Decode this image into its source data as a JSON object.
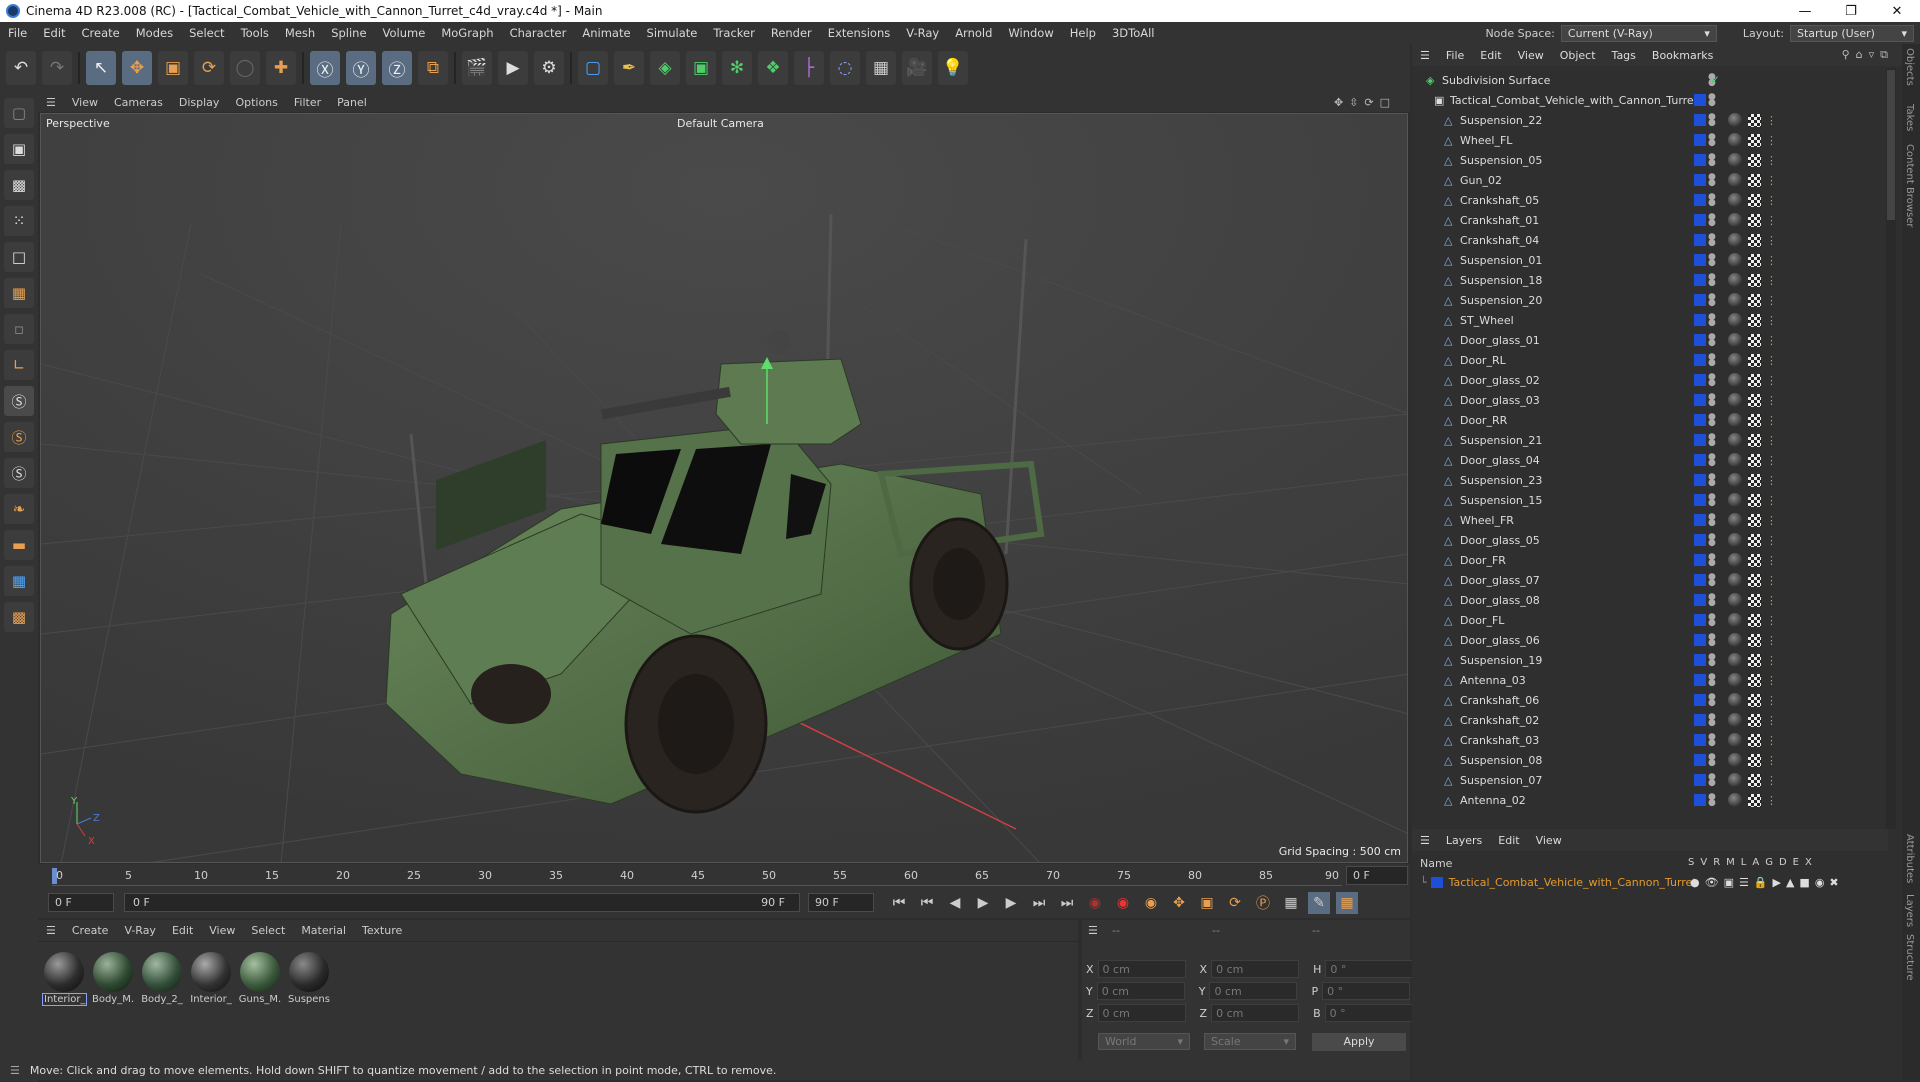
{
  "window": {
    "title": "Cinema 4D R23.008 (RC) - [Tactical_Combat_Vehicle_with_Cannon_Turret_c4d_vray.c4d *] - Main"
  },
  "menubar": {
    "items": [
      "File",
      "Edit",
      "Create",
      "Modes",
      "Select",
      "Tools",
      "Mesh",
      "Spline",
      "Volume",
      "MoGraph",
      "Character",
      "Animate",
      "Simulate",
      "Tracker",
      "Render",
      "Extensions",
      "V-Ray",
      "Arnold",
      "Window",
      "Help",
      "3DToAll"
    ],
    "node_space_label": "Node Space:",
    "node_space_value": "Current (V-Ray)",
    "layout_label": "Layout:",
    "layout_value": "Startup (User)"
  },
  "viewport": {
    "menu": [
      "View",
      "Cameras",
      "Display",
      "Options",
      "Filter",
      "Panel"
    ],
    "view_name": "Perspective",
    "camera": "Default Camera",
    "grid_spacing": "Grid Spacing : 500 cm"
  },
  "timeline": {
    "ticks": [
      "0",
      "5",
      "10",
      "15",
      "20",
      "25",
      "30",
      "35",
      "40",
      "45",
      "50",
      "55",
      "60",
      "65",
      "70",
      "75",
      "80",
      "85",
      "90"
    ],
    "current_frame": "0 F",
    "start_frame": "0 F",
    "range_start": "0 F",
    "range_end": "90 F",
    "end_frame": "90 F"
  },
  "materials": {
    "menu": [
      "Create",
      "V-Ray",
      "Edit",
      "View",
      "Select",
      "Material",
      "Texture"
    ],
    "items": [
      {
        "label": "Interior_",
        "color": "#2c2c2c"
      },
      {
        "label": "Body_M.",
        "color": "#2f4a32"
      },
      {
        "label": "Body_2_",
        "color": "#34503a"
      },
      {
        "label": "Interior_",
        "color": "#333333"
      },
      {
        "label": "Guns_M.",
        "color": "#3c5a3c"
      },
      {
        "label": "Suspens",
        "color": "#2a2a2a"
      }
    ]
  },
  "coordinates": {
    "header": [
      "--",
      "--",
      "--"
    ],
    "rows": [
      {
        "axis": "X",
        "pos": "0 cm",
        "axis2": "X",
        "size": "0 cm",
        "rot_label": "H",
        "rot": "0 °"
      },
      {
        "axis": "Y",
        "pos": "0 cm",
        "axis2": "Y",
        "size": "0 cm",
        "rot_label": "P",
        "rot": "0 °"
      },
      {
        "axis": "Z",
        "pos": "0 cm",
        "axis2": "Z",
        "size": "0 cm",
        "rot_label": "B",
        "rot": "0 °"
      }
    ],
    "mode": "World",
    "transform": "Scale",
    "apply": "Apply"
  },
  "status": "Move: Click and drag to move elements. Hold down SHIFT to quantize movement / add to the selection in point mode, CTRL to remove.",
  "objects": {
    "menu": [
      "File",
      "Edit",
      "View",
      "Object",
      "Tags",
      "Bookmarks"
    ],
    "root": "Subdivision Surface",
    "group": "Tactical_Combat_Vehicle_with_Cannon_Turret",
    "items": [
      "Suspension_22",
      "Wheel_FL",
      "Suspension_05",
      "Gun_02",
      "Crankshaft_05",
      "Crankshaft_01",
      "Crankshaft_04",
      "Suspension_01",
      "Suspension_18",
      "Suspension_20",
      "ST_Wheel",
      "Door_glass_01",
      "Door_RL",
      "Door_glass_02",
      "Door_glass_03",
      "Door_RR",
      "Suspension_21",
      "Door_glass_04",
      "Suspension_23",
      "Suspension_15",
      "Wheel_FR",
      "Door_glass_05",
      "Door_FR",
      "Door_glass_07",
      "Door_glass_08",
      "Door_FL",
      "Door_glass_06",
      "Suspension_19",
      "Antenna_03",
      "Crankshaft_06",
      "Crankshaft_02",
      "Crankshaft_03",
      "Suspension_08",
      "Suspension_07",
      "Antenna_02"
    ]
  },
  "layers": {
    "menu": [
      "Layers",
      "Edit",
      "View"
    ],
    "col_name": "Name",
    "cols": [
      "S",
      "V",
      "R",
      "M",
      "L",
      "A",
      "G",
      "D",
      "E",
      "X"
    ],
    "item": "Tactical_Combat_Vehicle_with_Cannon_Turret",
    "item_color": "#1d4fd8"
  },
  "side_tabs": [
    "Objects",
    "Takes",
    "Content Browser",
    "Attributes",
    "Layers",
    "Structure"
  ]
}
